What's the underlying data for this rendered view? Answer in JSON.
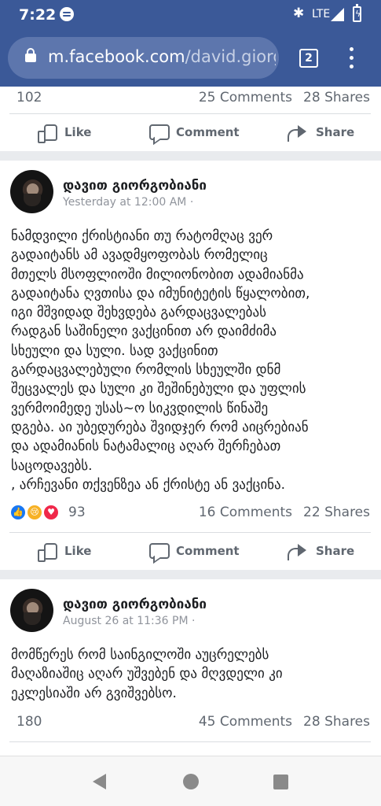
{
  "status_bar": {
    "time": "7:22",
    "network": "LTE",
    "bluetooth_icon": "bluetooth-icon",
    "battery_icon": "battery-charging-icon"
  },
  "browser": {
    "url_domain": "m.facebook.com",
    "url_path": "/david.giorgo",
    "tab_count": "2"
  },
  "actions": {
    "like": "Like",
    "comment": "Comment",
    "share": "Share"
  },
  "colors": {
    "brand": "#3b5998",
    "like_reaction": "#1877f2",
    "sad_reaction": "#f7b125",
    "love_reaction": "#f0284a"
  },
  "posts": [
    {
      "likes": "102",
      "comments": "25 Comments",
      "shares": "28 Shares"
    },
    {
      "author": "დავით გიორგობიანი",
      "time": "Yesterday at 12:00 AM ·",
      "text": "ნამდვილი ქრისტიანი თუ რატომღაც ვერ\nგადაიტანს ამ ავადმყოფობას რომელიც\nმთელს მსოფლიოში მილიონობით ადამიანმა\nგადაიტანა ღვთისა და იმუნიტეტის წყალობით,\nიგი მშვიდად შეხვდება გარდაცვალებას\nრადგან საშინელი ვაქცინით არ დაიმძიმა\nსხეული და სული. სად ვაქცინით\nგარდაცვალებული რომლის სხეულში დნმ\nშეცვალეს და სული კი შეშინებული და უფლის\nვერმოიმედე უსას~ო სიკვდილის წინაშე\nდგება. აი უბედურება შვიდჯერ რომ აიცრებიან\nდა ადამიანის ნატამალიც აღარ შერჩებათ\nსაცოდავებს.\n, არჩევანი თქვენზეა ან ქრისტე ან ვაქცინა.",
      "reactions": [
        "like-reaction-icon",
        "sad-reaction-icon",
        "love-reaction-icon"
      ],
      "likes": "93",
      "comments": "16 Comments",
      "shares": "22 Shares"
    },
    {
      "author": "დავით გიორგობიანი",
      "time": "August 26 at 11:36 PM ·",
      "text": "მომწერეს რომ საინგილოში აუცრელებს\nმაღაზიაშიც აღარ უშვებენ და მღვდელი კი\nეკლესიაში არ გვიშვებსო.",
      "likes": "180",
      "comments": "45 Comments",
      "shares": "28 Shares"
    }
  ]
}
